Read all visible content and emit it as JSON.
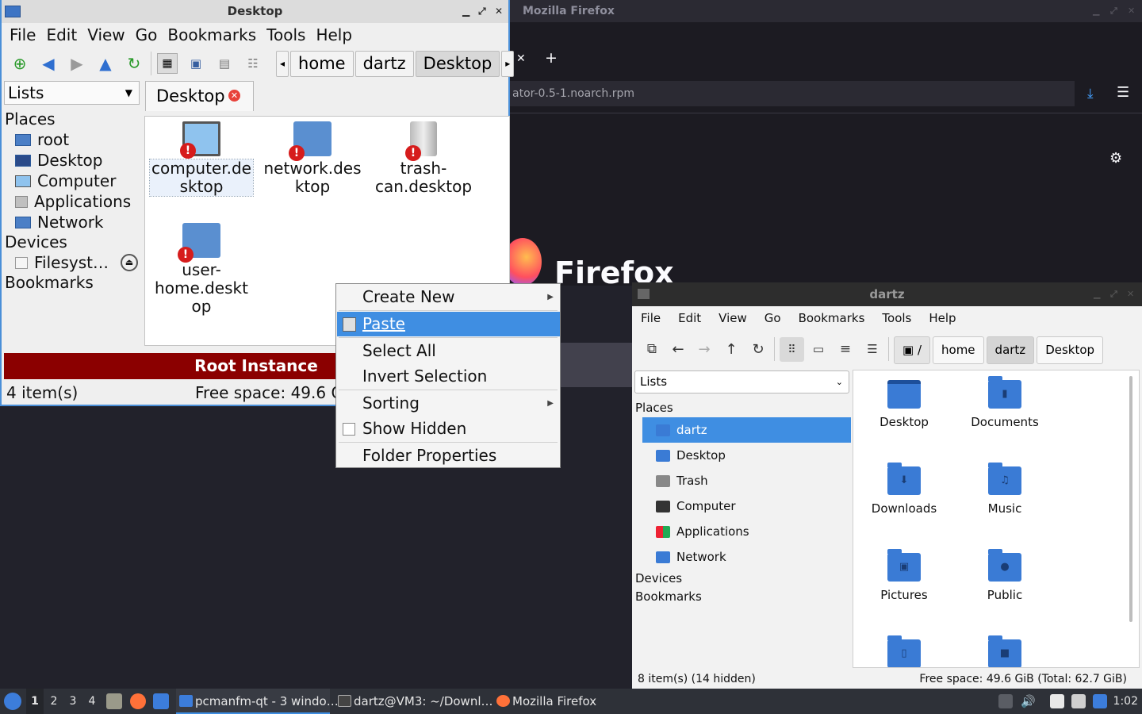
{
  "firefox": {
    "window_title": "Mozilla Firefox",
    "tab_close": "✕",
    "new_tab": "+",
    "url_text": "ator-0.5-1.noarch.rpm",
    "brand": "Firefox"
  },
  "pcmanfm_qt": {
    "title": "Desktop",
    "menu": [
      "File",
      "Edit",
      "View",
      "Go",
      "Bookmarks",
      "Tools",
      "Help"
    ],
    "breadcrumbs": [
      "home",
      "dartz",
      "Desktop"
    ],
    "lists_label": "Lists",
    "side_sections": {
      "places": "Places",
      "devices": "Devices",
      "bookmarks": "Bookmarks"
    },
    "places": [
      "root",
      "Desktop",
      "Computer",
      "Applications",
      "Network"
    ],
    "devices": [
      "Filesyst…"
    ],
    "tab_label": "Desktop",
    "files": [
      "computer.de sktop",
      "network.des ktop",
      "trash- can.desktop",
      "user- home.deskt op"
    ],
    "root_banner": "Root Instance",
    "status_items": "4 item(s)",
    "status_free": "Free space: 49.6 G"
  },
  "context_menu": {
    "items": [
      "Create New",
      "Paste",
      "Select All",
      "Invert Selection",
      "Sorting",
      "Show Hidden",
      "Folder Properties"
    ],
    "highlighted": "Paste"
  },
  "dartz": {
    "title": "dartz",
    "menu": [
      "File",
      "Edit",
      "View",
      "Go",
      "Bookmarks",
      "Tools",
      "Help"
    ],
    "breadcrumbs": [
      "/",
      "home",
      "dartz",
      "Desktop"
    ],
    "lists_label": "Lists",
    "side_sections": {
      "places": "Places",
      "devices": "Devices",
      "bookmarks": "Bookmarks"
    },
    "places": [
      "dartz",
      "Desktop",
      "Trash",
      "Computer",
      "Applications",
      "Network"
    ],
    "selected_place": "dartz",
    "folders": [
      "Desktop",
      "Documents",
      "Downloads",
      "Music",
      "Pictures",
      "Public"
    ],
    "status_items": "8 item(s) (14 hidden)",
    "status_free": "Free space: 49.6 GiB (Total: 62.7 GiB)"
  },
  "taskbar": {
    "workspaces": [
      "1",
      "2",
      "3",
      "4"
    ],
    "active_workspace": "1",
    "tasks": [
      "pcmanfm-qt - 3 windo…",
      "dartz@VM3: ~/Downl…",
      "Mozilla Firefox"
    ],
    "clock": "1:02"
  },
  "colors": {
    "accent": "#3f8ee2",
    "root_banner": "#8b0000",
    "folder_blue": "#3a7bd5"
  }
}
